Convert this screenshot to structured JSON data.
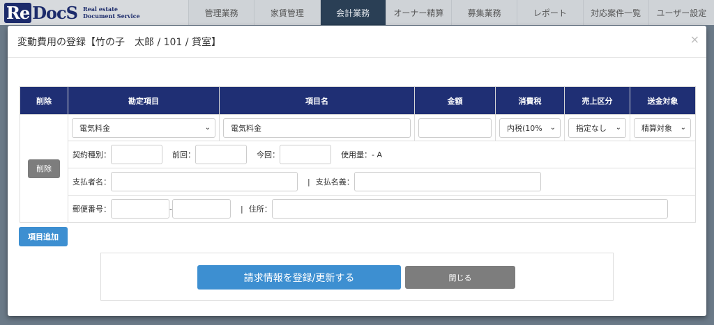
{
  "app": {
    "logo_mark": "ReDocS",
    "logo_sub_line1": "Real estate",
    "logo_sub_line2": "Document Service"
  },
  "nav": {
    "items": [
      "管理業務",
      "家賃管理",
      "会計業務",
      "オーナー精算",
      "募集業務",
      "レポート",
      "対応案件一覧",
      "ユーザー設定"
    ],
    "active_index": 2
  },
  "modal": {
    "title": "変動費用の登録【竹の子　太郎 / 101 / 貸室】",
    "close": "×",
    "table": {
      "headers": [
        "削除",
        "勘定項目",
        "項目名",
        "金額",
        "消費税",
        "売上区分",
        "送金対象"
      ],
      "row": {
        "delete_label": "削除",
        "account_item": "電気料金",
        "item_name": "電気料金",
        "amount": "",
        "tax": "内税(10%",
        "sales_category": "指定なし",
        "remit_target": "精算対象",
        "contract_type_label": "契約種別：",
        "contract_type_value": "",
        "previous_label": "前回：",
        "previous_value": "",
        "current_label": "今回：",
        "current_value": "",
        "usage_label": "使用量：- A",
        "payer_label": "支払者名：",
        "payer_value": "",
        "separator": "|",
        "payee_label": "支払名義：",
        "payee_value": "",
        "postal_label": "郵便番号：",
        "postal_value1": "",
        "postal_dash": "-",
        "postal_value2": "",
        "address_label": "住所：",
        "address_value": ""
      }
    },
    "add_item_label": "項目追加",
    "submit_label": "請求情報を登録/更新する",
    "close_label": "閉じる"
  },
  "colors": {
    "header_navy": "#1f2f74",
    "primary_blue": "#3d8fd1",
    "gray_button": "#7d7d7d",
    "highlight_red": "#d9252e",
    "nav_active": "#2a3f55"
  }
}
